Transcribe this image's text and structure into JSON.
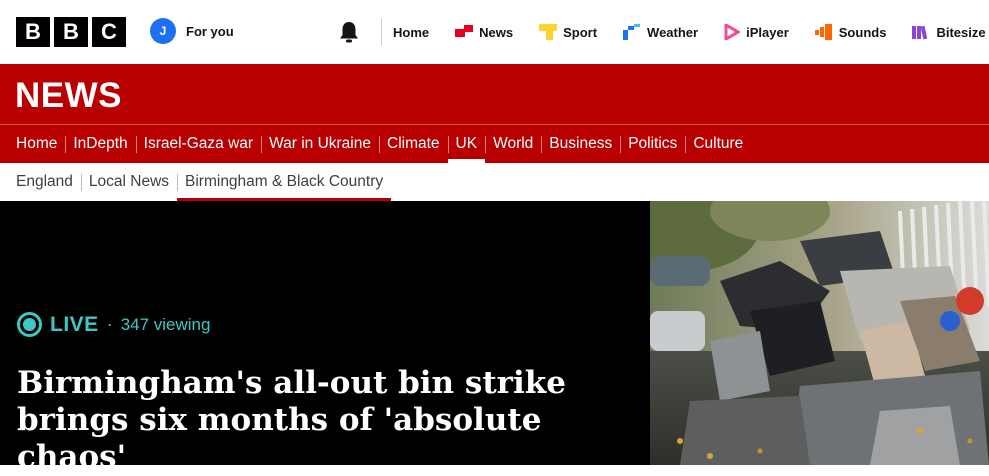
{
  "brand": {
    "letters": [
      "B",
      "B",
      "C"
    ]
  },
  "account": {
    "initial": "J",
    "label": "For you"
  },
  "global_nav": [
    {
      "label": "Home",
      "icon": ""
    },
    {
      "label": "News",
      "icon": "news-icon",
      "color": "#e9001e"
    },
    {
      "label": "Sport",
      "icon": "sport-icon",
      "color": "#ffd230"
    },
    {
      "label": "Weather",
      "icon": "weather-icon",
      "color": "#1d70f2"
    },
    {
      "label": "iPlayer",
      "icon": "iplayer-icon",
      "color": "#f54997"
    },
    {
      "label": "Sounds",
      "icon": "sounds-icon",
      "color": "#ff6600"
    },
    {
      "label": "Bitesize",
      "icon": "bitesize-icon",
      "color": "#8a45d6"
    }
  ],
  "news": {
    "title": "NEWS"
  },
  "section_nav": [
    {
      "label": "Home"
    },
    {
      "label": "InDepth"
    },
    {
      "label": "Israel-Gaza war"
    },
    {
      "label": "War in Ukraine"
    },
    {
      "label": "Climate"
    },
    {
      "label": "UK",
      "active": true
    },
    {
      "label": "World"
    },
    {
      "label": "Business"
    },
    {
      "label": "Politics"
    },
    {
      "label": "Culture"
    }
  ],
  "sub_nav": [
    {
      "label": "England"
    },
    {
      "label": "Local News"
    },
    {
      "label": "Birmingham & Black Country",
      "active": true
    }
  ],
  "hero": {
    "live_label": "LIVE",
    "separator": "·",
    "viewing": "347 viewing",
    "headline": "Birmingham's all-out bin strike brings six months of 'absolute chaos'"
  },
  "colors": {
    "bbc_red": "#b80000",
    "live_teal": "#3ec8c4"
  }
}
